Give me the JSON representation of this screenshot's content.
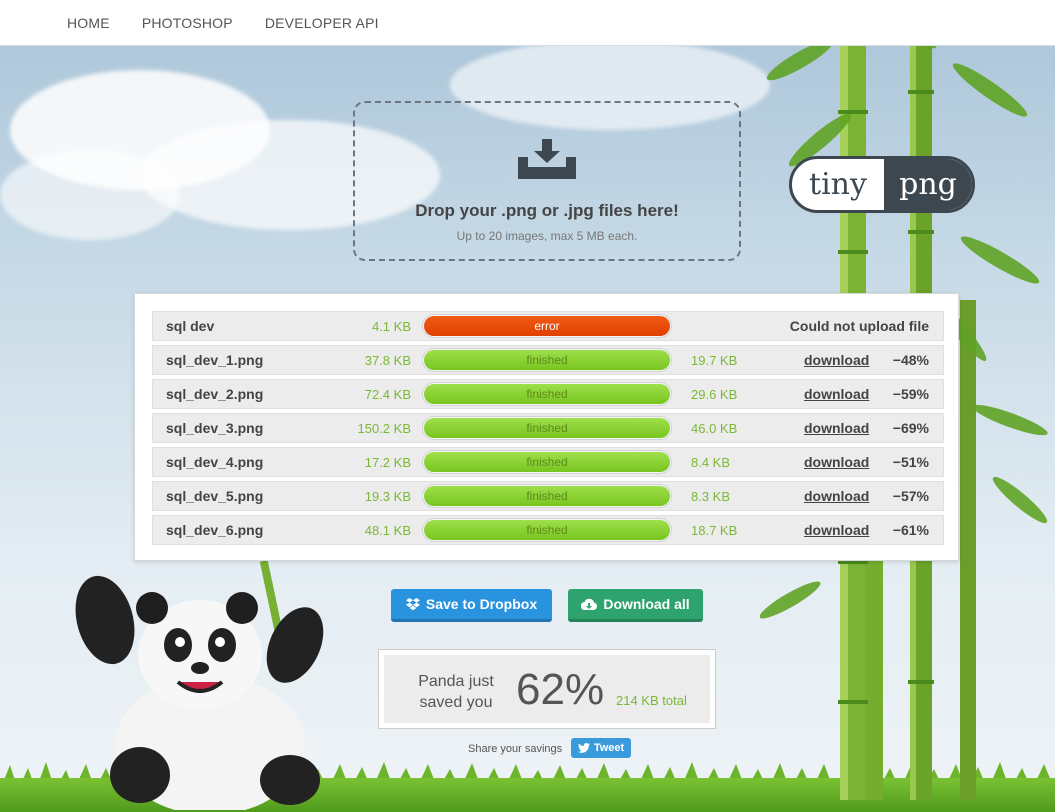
{
  "nav": {
    "items": [
      "HOME",
      "PHOTOSHOP",
      "DEVELOPER API"
    ]
  },
  "dropzone": {
    "icon": "download-tray-icon",
    "title": "Drop your .png or .jpg files here!",
    "subtitle": "Up to 20 images, max 5 MB each."
  },
  "logo": {
    "left": "tiny",
    "right": "png"
  },
  "files": [
    {
      "name": "sql dev",
      "size": "4.1 KB",
      "status": "error",
      "message": "Could not upload file"
    },
    {
      "name": "sql_dev_1.png",
      "size": "37.8 KB",
      "status": "finished",
      "new_size": "19.7 KB",
      "link": "download",
      "saving": "−48%"
    },
    {
      "name": "sql_dev_2.png",
      "size": "72.4 KB",
      "status": "finished",
      "new_size": "29.6 KB",
      "link": "download",
      "saving": "−59%"
    },
    {
      "name": "sql_dev_3.png",
      "size": "150.2 KB",
      "status": "finished",
      "new_size": "46.0 KB",
      "link": "download",
      "saving": "−69%"
    },
    {
      "name": "sql_dev_4.png",
      "size": "17.2 KB",
      "status": "finished",
      "new_size": "8.4 KB",
      "link": "download",
      "saving": "−51%"
    },
    {
      "name": "sql_dev_5.png",
      "size": "19.3 KB",
      "status": "finished",
      "new_size": "8.3 KB",
      "link": "download",
      "saving": "−57%"
    },
    {
      "name": "sql_dev_6.png",
      "size": "48.1 KB",
      "status": "finished",
      "new_size": "18.7 KB",
      "link": "download",
      "saving": "−61%"
    }
  ],
  "actions": {
    "dropbox_label": "Save to Dropbox",
    "download_all_label": "Download all"
  },
  "savings": {
    "text": "Panda just saved you",
    "percent": "62%",
    "total": "214 KB total",
    "share_label": "Share your savings",
    "tweet_label": "Tweet"
  },
  "colors": {
    "error": "#e84a0a",
    "finished": "#8bd636",
    "size_text": "#7ab837",
    "dropbox": "#2a93e0",
    "download_all": "#2fa36f"
  }
}
